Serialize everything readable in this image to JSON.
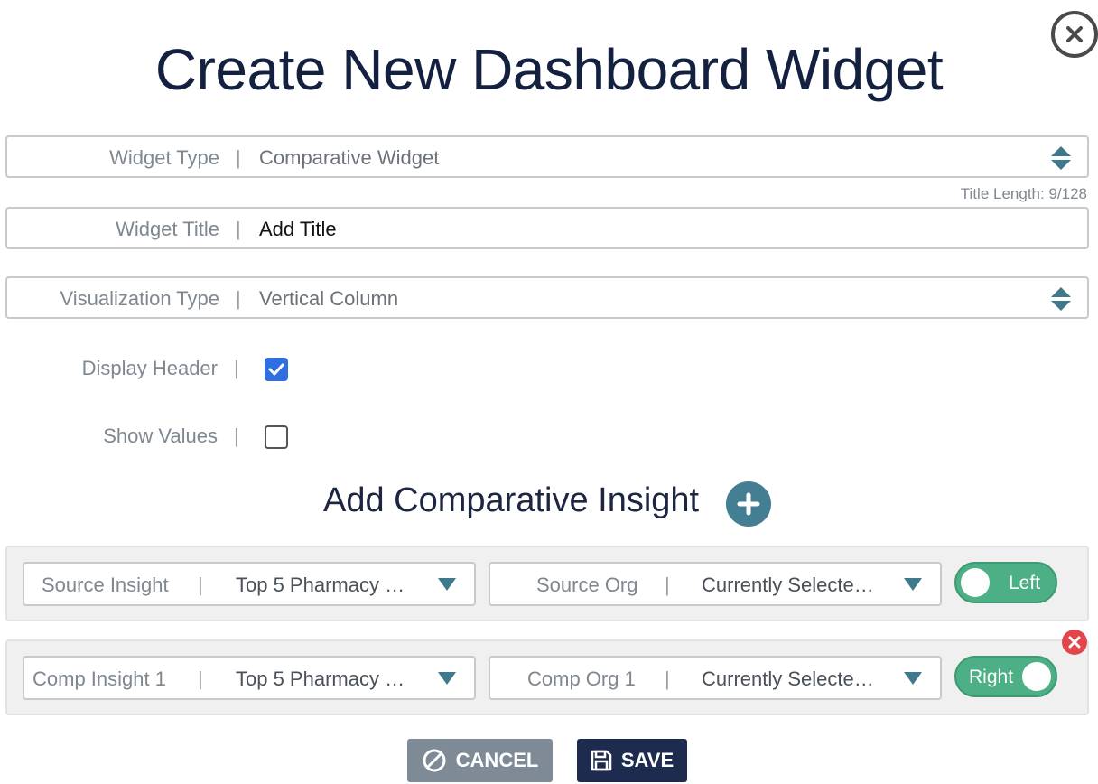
{
  "modal": {
    "title": "Create New Dashboard Widget"
  },
  "fields": {
    "widget_type": {
      "label": "Widget Type",
      "separator": "|",
      "value": "Comparative Widget"
    },
    "title_length": "Title Length: 9/128",
    "widget_title": {
      "label": "Widget Title",
      "separator": "|",
      "value": "Add Title"
    },
    "visualization_type": {
      "label": "Visualization Type",
      "separator": "|",
      "value": "Vertical Column"
    },
    "display_header": {
      "label": "Display Header",
      "separator": "|",
      "checked": true
    },
    "show_values": {
      "label": "Show Values",
      "separator": "|",
      "checked": false
    }
  },
  "insights": {
    "heading": "Add Comparative Insight",
    "rows": [
      {
        "insight_label": "Source Insight",
        "insight_value": "Top 5 Pharmacy …",
        "org_label": "Source Org",
        "org_value": "Currently Selecte…",
        "toggle_label": "Left",
        "toggle_state": "left"
      },
      {
        "insight_label": "Comp Insight 1",
        "insight_value": "Top 5 Pharmacy …",
        "org_label": "Comp Org 1",
        "org_value": "Currently Selecte…",
        "toggle_label": "Right",
        "toggle_state": "right"
      }
    ]
  },
  "actions": {
    "cancel_label": "CANCEL",
    "save_label": "SAVE"
  },
  "icons": {
    "close": "close-icon",
    "stepper": "up-down-stepper-icon",
    "add": "plus-icon",
    "remove": "remove-x-icon",
    "cancel": "ban-icon",
    "save": "floppy-disk-icon"
  },
  "colors": {
    "title": "#13203f",
    "teal": "#437e93",
    "toggle_green": "#4caf85",
    "checkbox_blue": "#2f6fe0",
    "remove_red": "#e0464b",
    "cancel_gray": "#7e8a95",
    "save_navy": "#1d2b4f"
  }
}
